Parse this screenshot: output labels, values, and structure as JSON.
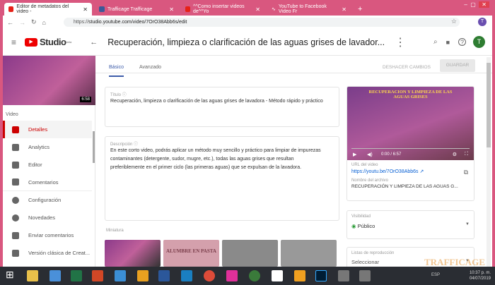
{
  "browser": {
    "tabs": [
      {
        "title": "Editor de metadatos del video -",
        "color": "#e62117"
      },
      {
        "title": "Trafficage Trafficage",
        "color": "#3b5998"
      },
      {
        "title": "^^Como insertar videos de^^Yo",
        "color": "#e62117"
      },
      {
        "title": "YouTube to Facebook Video Fr",
        "color": "#d9577f"
      }
    ],
    "new_tab": "+",
    "url_scheme": "https://",
    "url": "studio.youtube.com/video/7OrO38Abb6s/edit",
    "profile_initial": "T"
  },
  "header": {
    "logo": "Studio",
    "logo_badge": "beta",
    "title": "Recuperación, limpieza o clarificación de las aguas grises de lavador...",
    "avatar": "T"
  },
  "sidebar": {
    "section": "Video",
    "thumb_duration": "6:58",
    "items": [
      {
        "label": "Detalles",
        "icon": "pencil-icon"
      },
      {
        "label": "Analytics",
        "icon": "analytics-icon"
      },
      {
        "label": "Editor",
        "icon": "film-icon"
      },
      {
        "label": "Comentarios",
        "icon": "comment-icon"
      },
      {
        "label": "Configuración",
        "icon": "gear-icon"
      },
      {
        "label": "Novedades",
        "icon": "alert-icon"
      },
      {
        "label": "Enviar comentarios",
        "icon": "feedback-icon"
      },
      {
        "label": "Versión clásica de Creat...",
        "icon": "classic-icon"
      }
    ]
  },
  "main": {
    "tabs": [
      "Básico",
      "Avanzado"
    ],
    "undo": "DESHACER CAMBIOS",
    "save": "GUARDAR",
    "title_label": "Título",
    "title_value": "Recuperación,  limpieza o clarificación de las aguas grises de lavadora - Método rápido y práctico",
    "desc_label": "Descripción",
    "desc_value": "En este corto video, podrás aplicar un método muy sencillo y práctico para limpiar  de impurezas contaminantes (detergente, sudor, mugre, etc.), todas las aguas grises que resultan preferiblemente en el primer ciclo (las primeras aguas) que se  expulsan de la lavadora.",
    "thumb_label": "Miniatura",
    "thumb_text": "ALUMBRE EN PASTA"
  },
  "right": {
    "video_title": "RECUPERACION Y LIMPIEZA DE LAS AGUAS GRISES",
    "time": "0:00 / 6:57",
    "url_label": "URL del video",
    "url": "https://youtu.be/7OrO38Abb6s",
    "file_label": "Nombre del archivo",
    "file": "RECUPERACIÓN Y LIMPIEZA DE LAS AGUAS G...",
    "vis_label": "Visibilidad",
    "vis_value": "Público",
    "list_label": "Listas de reproducción",
    "list_value": "Seleccionar"
  },
  "taskbar": {
    "time": "10:37 p. m.",
    "date": "04/07/2019",
    "lang": "ESP"
  },
  "watermark": "TRAFFICAGE",
  "colors": {
    "accent": "#c00",
    "link": "#065fd4",
    "frame": "#d9577f"
  }
}
